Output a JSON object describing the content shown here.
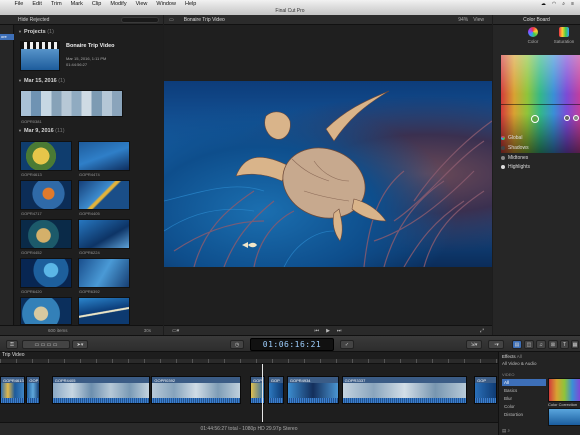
{
  "menubar": {
    "items": [
      "File",
      "Edit",
      "Trim",
      "Mark",
      "Clip",
      "Modify",
      "View",
      "Window",
      "Help"
    ]
  },
  "window": {
    "title": "Final Cut Pro"
  },
  "library": {
    "selected_label": "ore"
  },
  "browser": {
    "filter": "Hide Rejected",
    "projects_header": "Projects",
    "projects_count": "(1)",
    "project": {
      "name": "Bonaire Trip Video",
      "date": "Mar 15, 2016, 1:11 PM",
      "duration": "01:44:56:27"
    },
    "group1": {
      "header": "Mar 15, 2016",
      "count": "(1)",
      "clip": "GOPR0381"
    },
    "group2": {
      "header": "Mar 9, 2016",
      "count": "(11)"
    },
    "clips": [
      "GOPR4613",
      "GOPR4474",
      "GOPR4717",
      "GOPR4405",
      "GOPR4452",
      "GOPR6224",
      "GOPR6420",
      "GOPR6392"
    ],
    "items_count": "600 items",
    "zoom": "30s"
  },
  "viewer": {
    "title": "Bonaire Trip Video",
    "zoom": "94%",
    "view_menu": "View"
  },
  "inspector": {
    "title": "Color Board",
    "tab_color": "Color",
    "tab_saturation": "Saturation",
    "ranges": [
      "Global",
      "Shadows",
      "Midtones",
      "Highlights"
    ]
  },
  "timecode": "01:06:16:21",
  "timeline": {
    "title": "Trip Video",
    "clips": [
      {
        "name": "GOPR4613",
        "start": 0.0,
        "end": 0.053
      },
      {
        "name": "GOP",
        "start": 0.053,
        "end": 0.082
      },
      {
        "name": "GOPR4405",
        "start": 0.104,
        "end": 0.304
      },
      {
        "name": "GOPR0392",
        "start": 0.304,
        "end": 0.486
      },
      {
        "name": "GOP",
        "start": 0.502,
        "end": 0.534
      },
      {
        "name": "GOP",
        "start": 0.538,
        "end": 0.572
      },
      {
        "name": "GOPR4934",
        "start": 0.576,
        "end": 0.683
      },
      {
        "name": "GOPR3337",
        "start": 0.686,
        "end": 0.94
      },
      {
        "name": "GOP",
        "start": 0.952,
        "end": 1.0
      }
    ],
    "status": "01:44:56:27 total - 1080p HD 29.97p Stereo"
  },
  "effects": {
    "title": "Effects",
    "all_label": "All",
    "all_video_audio": "All Video & Audio",
    "section": "VIDEO",
    "items": [
      "All",
      "Basics",
      "Blur",
      "Color",
      "Distortion"
    ],
    "thumb_label": "Color Correction"
  }
}
